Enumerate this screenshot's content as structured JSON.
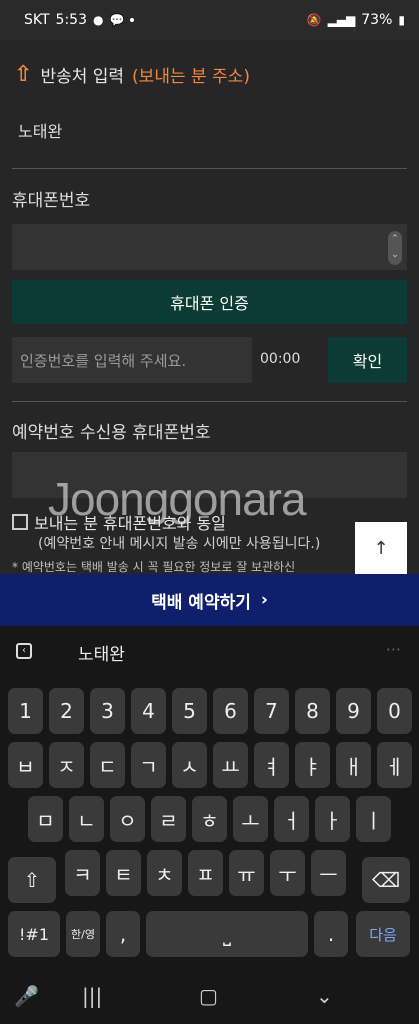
{
  "status": {
    "carrier": "SKT",
    "time": "5:53",
    "battery": "73%"
  },
  "form": {
    "section_title": "반송처 입력",
    "section_title_highlight": "(보내는 분 주소)",
    "sender_name": "노태완",
    "phone_label": "휴대폰번호",
    "phone_verify_button": "휴대폰 인증",
    "cert_placeholder": "인증번호를 입력해 주세요.",
    "timer": "00:00",
    "confirm_button": "확인",
    "reserve_phone_label": "예약번호 수신용 휴대폰번호",
    "same_as_sender": "보내는 분 휴대폰번호와 동일",
    "same_as_sender_note": "(예약번호 안내 메시지 발송 시에만 사용됩니다.)",
    "footnote": "*  예약번호는 택배 발송 시 꼭 필요한 정보로 잘 보관하신",
    "watermark": "Joonggonara",
    "scroll_top": "↑"
  },
  "cta": {
    "label": "택배 예약하기",
    "chevron": "›"
  },
  "keyboard": {
    "suggestion": "노태완",
    "row1": [
      "1",
      "2",
      "3",
      "4",
      "5",
      "6",
      "7",
      "8",
      "9",
      "0"
    ],
    "row2": [
      "ㅂ",
      "ㅈ",
      "ㄷ",
      "ㄱ",
      "ㅅ",
      "ㅛ",
      "ㅕ",
      "ㅑ",
      "ㅐ",
      "ㅔ"
    ],
    "row3": [
      "ㅁ",
      "ㄴ",
      "ㅇ",
      "ㄹ",
      "ㅎ",
      "ㅗ",
      "ㅓ",
      "ㅏ",
      "ㅣ"
    ],
    "row4": [
      "ㅋ",
      "ㅌ",
      "ㅊ",
      "ㅍ",
      "ㅠ",
      "ㅜ",
      "ㅡ"
    ],
    "symbols_key": "!#1",
    "lang_key": "한/영",
    "comma": ",",
    "period": ".",
    "enter_key": "다음"
  }
}
